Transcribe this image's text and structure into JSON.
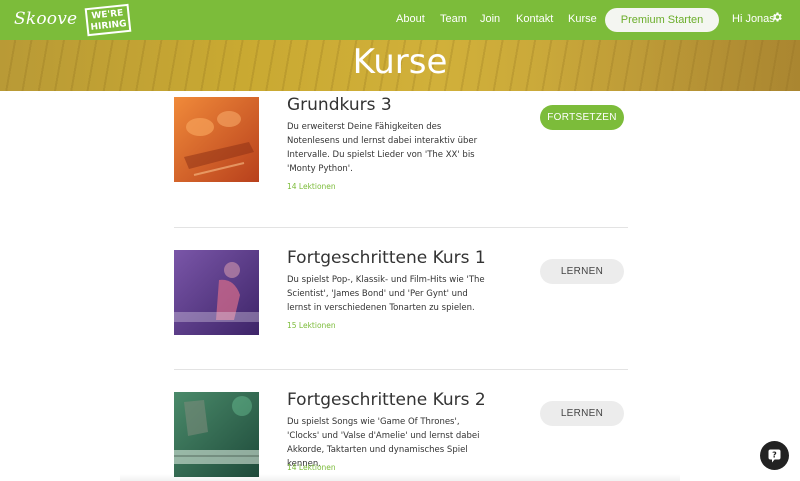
{
  "nav": {
    "logo_text": "Skoove",
    "hiring_line1": "WE'RE",
    "hiring_line2": "HIRING",
    "links": [
      "About",
      "Team",
      "Join",
      "Kontakt",
      "Kurse"
    ],
    "premium_label": "Premium Starten",
    "greeting": "Hi Jonas",
    "settings_icon": "gear-icon"
  },
  "banner": {
    "title": "Kurse"
  },
  "courses": [
    {
      "title": "Grundkurs 3",
      "description": "Du erweiterst Deine Fähigkeiten des Notenlesens und lernst dabei interaktiv über Intervalle. Du spielst Lieder von 'The XX' bis 'Monty Python'.",
      "lessons": "14 Lektionen",
      "button": "FORTSETZEN"
    },
    {
      "title": "Fortgeschrittene Kurs 1",
      "description": "Du spielst Pop-, Klassik- und Film-Hits wie 'The Scientist', 'James Bond' und 'Per Gynt' und lernst in verschiedenen Tonarten zu spielen.",
      "lessons": "15 Lektionen",
      "button": "LERNEN"
    },
    {
      "title": "Fortgeschrittene Kurs 2",
      "description": "Du spielst Songs wie 'Game Of Thrones', 'Clocks' und 'Valse d'Amelie' und lernst dabei Akkorde, Taktarten und dynamisches Spiel kennen.",
      "lessons": "14 Lektionen",
      "button": "LERNEN"
    }
  ],
  "help": {
    "icon": "help-chat-icon"
  },
  "colors": {
    "brand_green": "#7cbc3a",
    "banner_gold": "#c9a932",
    "button_gray": "#ececec"
  }
}
